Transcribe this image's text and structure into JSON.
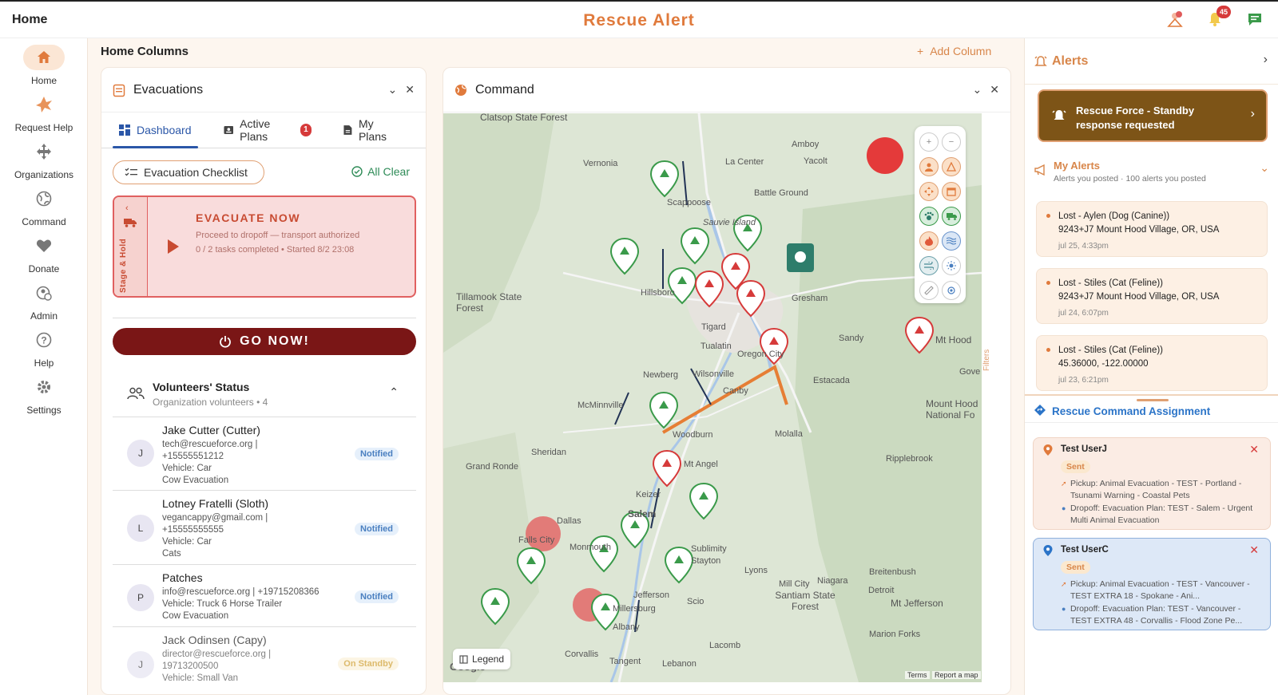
{
  "topbar": {
    "home_title": "Home",
    "app_title": "Rescue Alert",
    "notif_count": "45"
  },
  "sidebar": {
    "items": [
      {
        "label": "Home"
      },
      {
        "label": "Request Help"
      },
      {
        "label": "Organizations"
      },
      {
        "label": "Command"
      },
      {
        "label": "Donate"
      },
      {
        "label": "Admin"
      },
      {
        "label": "Help"
      },
      {
        "label": "Settings"
      }
    ]
  },
  "home_columns": {
    "title": "Home Columns",
    "add_column": "Add Column"
  },
  "evacuations": {
    "title": "Evacuations",
    "tabs": [
      {
        "label": "Dashboard"
      },
      {
        "label": "Active Plans",
        "badge": "1"
      },
      {
        "label": "My Plans"
      }
    ],
    "checklist_label": "Evacuation Checklist",
    "all_clear": "All Clear",
    "card": {
      "side_label": "Stage & Hold",
      "title": "EVACUATE NOW",
      "desc": "Proceed to dropoff — transport authorized",
      "meta": "0 / 2 tasks completed  •  Started 8/2 23:08"
    },
    "go_now": "GO NOW!",
    "volunteers": {
      "title": "Volunteers' Status",
      "subtitle": "Organization volunteers • 4",
      "rows": [
        {
          "initial": "J",
          "name": "Jake Cutter (Cutter)",
          "lines": [
            "tech@rescueforce.org  |",
            "+15555551212",
            "Vehicle: Car",
            "Cow Evacuation"
          ],
          "status": "Notified"
        },
        {
          "initial": "L",
          "name": "Lotney Fratelli (Sloth)",
          "lines": [
            "vegancappy@gmail.com  |",
            "+15555555555",
            "Vehicle: Car",
            "Cats"
          ],
          "status": "Notified"
        },
        {
          "initial": "P",
          "name": "Patches",
          "lines": [
            "info@rescueforce.org  |  +19715208366",
            "Vehicle: Truck 6 Horse Trailer",
            "Cow Evacuation"
          ],
          "status": "Notified"
        },
        {
          "initial": "J",
          "name": "Jack Odinsen (Capy)",
          "lines": [
            "director@rescueforce.org  |",
            "19713200500",
            "Vehicle: Small Van"
          ],
          "status": "On Standby"
        }
      ]
    }
  },
  "command": {
    "title": "Command",
    "legend": "Legend",
    "filters": "Filters",
    "footer": {
      "terms": "Terms",
      "report": "Report a map"
    },
    "places": [
      "Clatsop State Forest",
      "Vernonia",
      "La Center",
      "Amboy",
      "Yacolt",
      "Battle Ground",
      "Scappoose",
      "Sauvie Island",
      "Tillamook State Forest",
      "Hillsboro",
      "Gresham",
      "Tigard",
      "Tualatin",
      "Oregon City",
      "Sandy",
      "Newberg",
      "Wilsonville",
      "Canby",
      "Estacada",
      "McMinnville",
      "Woodburn",
      "Molalla",
      "Sheridan",
      "Grand Ronde",
      "Mt Angel",
      "Ripplebrook",
      "Keizer",
      "Dallas",
      "Falls City",
      "Salem",
      "Monmouth",
      "Sublimity",
      "Stayton",
      "Lyons",
      "Jefferson",
      "Scio",
      "Mill City",
      "Niagara",
      "Santiam State Forest",
      "Detroit",
      "Mt Jefferson",
      "Albany",
      "Lacomb",
      "Corvallis",
      "Tangent",
      "Lebanon",
      "Marion Forks",
      "Breitenbush",
      "Mt Hood",
      "Mount Hood National Fo",
      "Gove",
      "Millersburg",
      "Google"
    ]
  },
  "alerts": {
    "title": "Alerts",
    "standby": "Rescue Force - Standby response requested",
    "my_alerts": {
      "title": "My Alerts",
      "subtitle": "Alerts you posted · 100 alerts you posted"
    },
    "items": [
      {
        "line1": "Lost - Aylen (Dog (Canine))",
        "line2": "9243+J7 Mount Hood Village, OR, USA",
        "time": "jul 25, 4:33pm"
      },
      {
        "line1": "Lost - Stiles (Cat (Feline))",
        "line2": "9243+J7 Mount Hood Village, OR, USA",
        "time": "jul 24, 6:07pm"
      },
      {
        "line1": "Lost - Stiles (Cat (Feline))",
        "line2": "45.36000, -122.00000",
        "time": "jul 23, 6:21pm"
      }
    ],
    "rca": {
      "title": "Rescue Command Assignment",
      "assignments": [
        {
          "name": "Test UserJ",
          "status": "Sent",
          "pickup": "Pickup: Animal Evacuation - TEST - Portland - Tsunami Warning - Coastal Pets",
          "dropoff": "Dropoff: Evacuation Plan: TEST - Salem - Urgent Multi Animal Evacuation"
        },
        {
          "name": "Test UserC",
          "status": "Sent",
          "pickup": "Pickup: Animal Evacuation - TEST - Vancouver - TEST EXTRA 18 - Spokane - Ani...",
          "dropoff": "Dropoff: Evacuation Plan: TEST - Vancouver - TEST EXTRA 48 - Corvallis - Flood Zone Pe..."
        }
      ]
    }
  },
  "colors": {
    "accent": "#e07a3c",
    "danger": "#7a1616",
    "blue": "#2b74c8"
  }
}
